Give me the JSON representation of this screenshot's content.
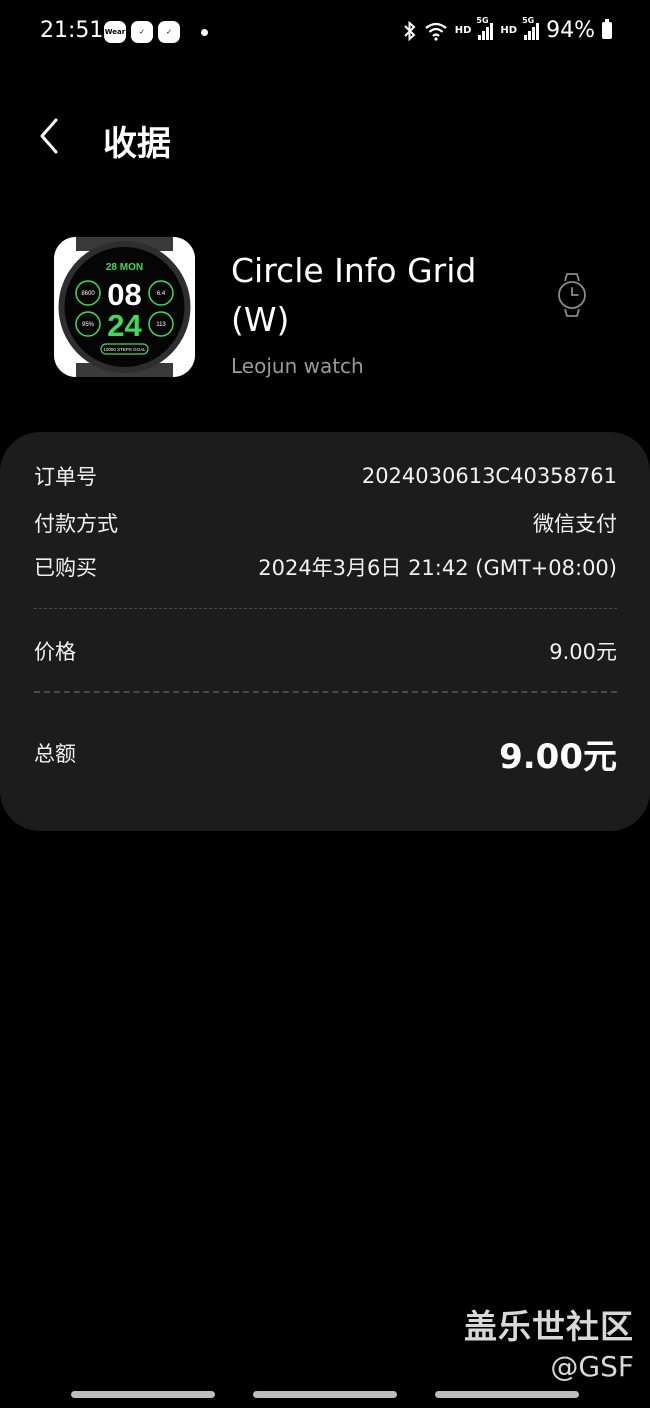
{
  "status_bar": {
    "time": "21:51",
    "notifications": [
      "Wear",
      "✓",
      "✓"
    ],
    "hd1": "HD",
    "hd2": "HD",
    "net1": "5G",
    "net2": "5G",
    "battery": "94%"
  },
  "header": {
    "back_icon": "chevron-left-icon",
    "title": "收据"
  },
  "product": {
    "name": "Circle Info Grid (W)",
    "developer": "Leojun watch",
    "thumb": {
      "date": "28 MON",
      "hour": "08",
      "minute": "24",
      "left_top": "8600",
      "left_bottom": "95%",
      "right_top": "6.4",
      "right_bottom": "113",
      "steps": "10000 STEPS GOAL"
    },
    "device_icon": "watch-icon"
  },
  "receipt": {
    "rows": [
      {
        "label": "订单号",
        "value": "2024030613C40358761"
      },
      {
        "label": "付款方式",
        "value": "微信支付"
      },
      {
        "label": "已购买",
        "value": "2024年3月6日 21:42 (GMT+08:00)"
      }
    ],
    "price": {
      "label": "价格",
      "value": "9.00元"
    },
    "total": {
      "label": "总额",
      "value": "9.00元"
    }
  },
  "watermark": {
    "brand": "盖乐世社区",
    "handle": "@GSF"
  },
  "colors": {
    "background": "#000000",
    "card": "#1c1c1c",
    "watch_accent": "#3ddc5a",
    "secondary_text": "#9a9a9a"
  }
}
